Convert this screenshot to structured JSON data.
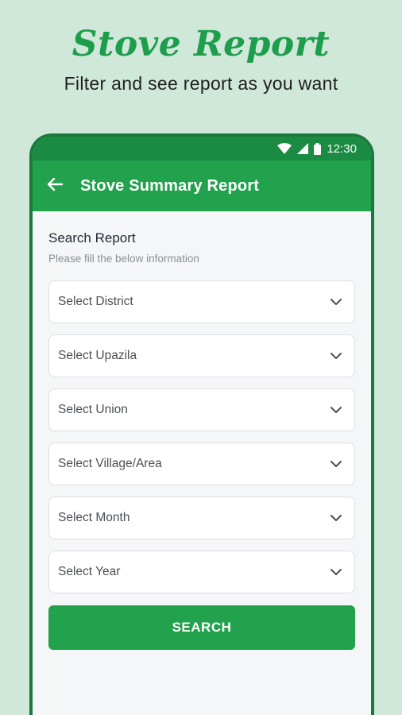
{
  "promo": {
    "title": "Stove Report",
    "subtitle": "Filter and see report as you want"
  },
  "status_bar": {
    "time": "12:30",
    "icons": [
      "wifi-icon",
      "signal-icon",
      "battery-icon"
    ]
  },
  "app_bar": {
    "back_icon": "arrow-left-icon",
    "title": "Stove Summary Report",
    "color": "#22a24d"
  },
  "form": {
    "title": "Search Report",
    "subtitle": "Please fill the below information",
    "fields": [
      {
        "label": "Select District"
      },
      {
        "label": "Select Upazila"
      },
      {
        "label": "Select Union"
      },
      {
        "label": "Select Village/Area"
      },
      {
        "label": "Select Month"
      },
      {
        "label": "Select Year"
      }
    ],
    "search_label": "SEARCH"
  },
  "colors": {
    "brand_green": "#22a24d",
    "background": "#cfe8da"
  }
}
